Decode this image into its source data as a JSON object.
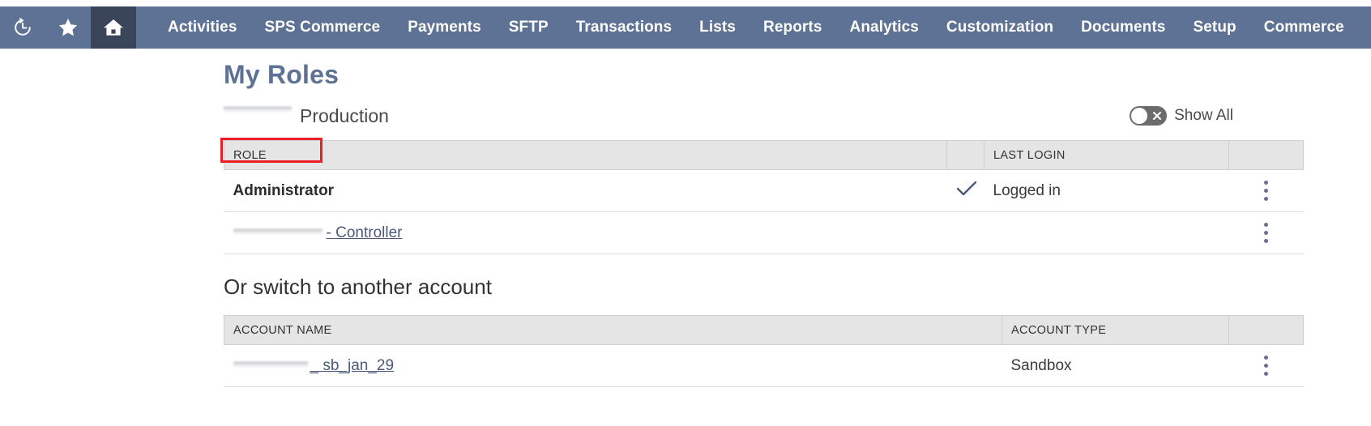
{
  "navbar": {
    "icons": [
      {
        "name": "history-icon",
        "label": "Recent Records"
      },
      {
        "name": "star-icon",
        "label": "Shortcuts"
      },
      {
        "name": "home-icon",
        "label": "Home"
      }
    ],
    "active_icon": "home-icon",
    "links": [
      "Activities",
      "SPS Commerce",
      "Payments",
      "SFTP",
      "Transactions",
      "Lists",
      "Reports",
      "Analytics",
      "Customization",
      "Documents",
      "Setup",
      "Commerce"
    ],
    "background_color": "#5d7294",
    "active_background_color": "#3b4559"
  },
  "page": {
    "title": "My Roles",
    "title_color": "#5d7294",
    "subline": {
      "redacted_prefix": "",
      "environment": "Production"
    },
    "show_all_toggle": {
      "label": "Show All",
      "state": "off",
      "icon": "x-icon"
    }
  },
  "roles_table": {
    "headers": [
      "ROLE",
      "",
      "LAST LOGIN",
      ""
    ],
    "rows": [
      {
        "role": "Administrator",
        "role_redacted_prefix": "",
        "is_link": false,
        "checked": true,
        "last_login": "Logged in",
        "menu_icon": "kebab-menu-icon"
      },
      {
        "role": "- Controller",
        "role_redacted_prefix": "",
        "is_link": true,
        "checked": false,
        "last_login": "",
        "menu_icon": "kebab-menu-icon"
      }
    ]
  },
  "switch_section": {
    "heading": "Or switch to another account",
    "headers": [
      "ACCOUNT NAME",
      "ACCOUNT TYPE",
      ""
    ],
    "rows": [
      {
        "account_redacted_prefix": "",
        "account_name": "_ sb_jan_29",
        "account_type": "Sandbox",
        "menu_icon": "kebab-menu-icon"
      }
    ]
  },
  "annotation": {
    "highlight_target": "ROLE",
    "color": "#ee1c25"
  }
}
